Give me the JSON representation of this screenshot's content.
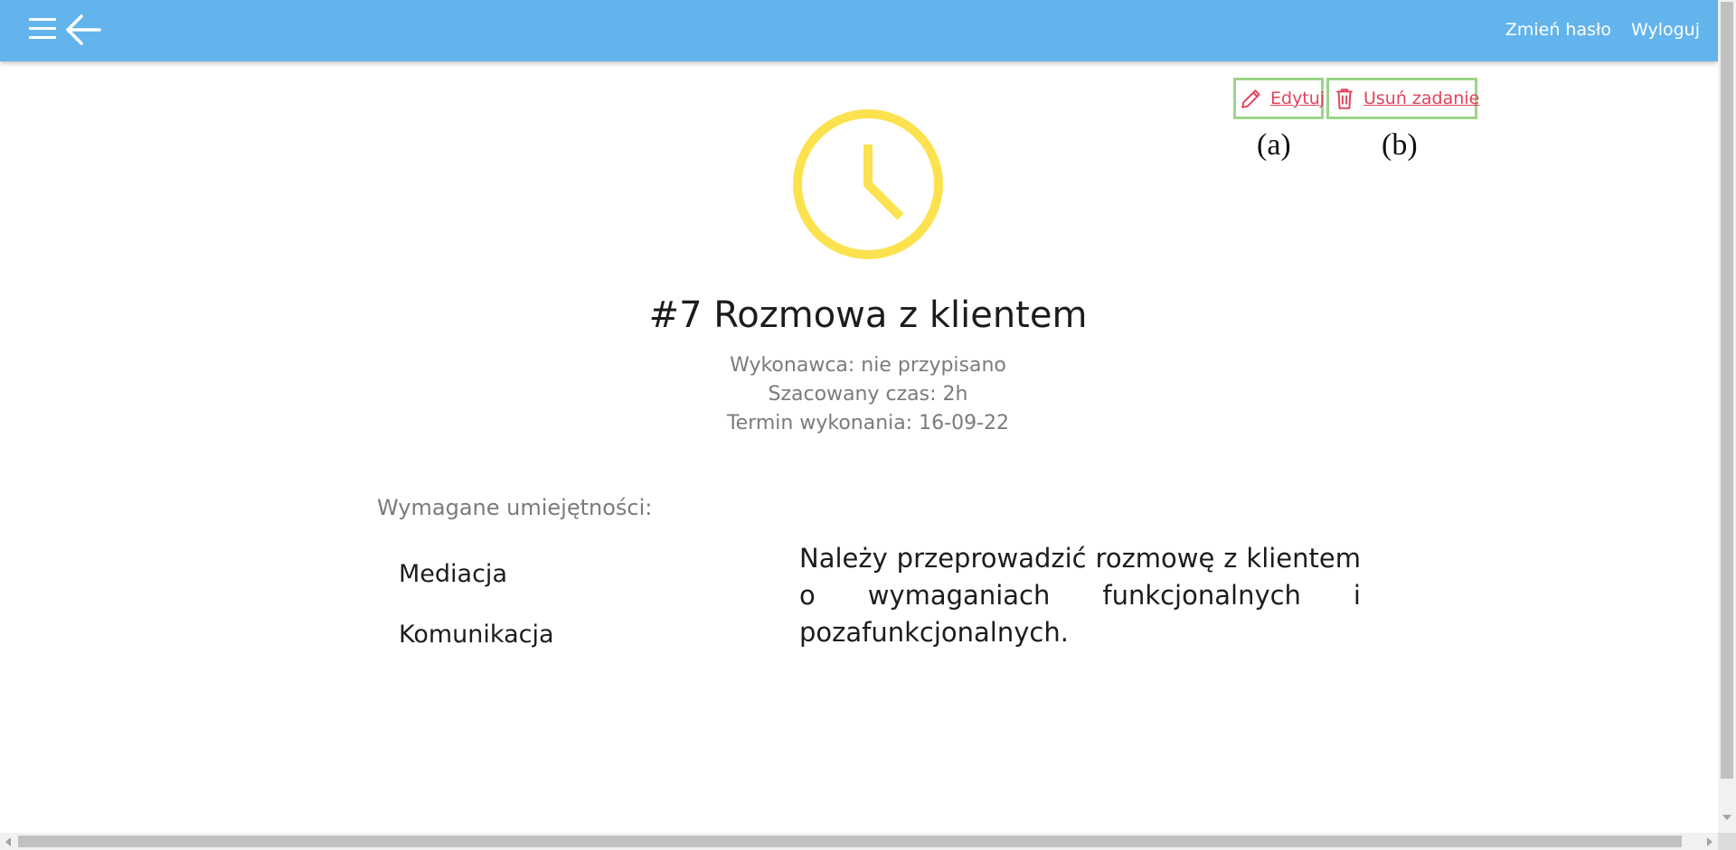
{
  "header": {
    "change_password": "Zmień hasło",
    "logout": "Wyloguj",
    "menu_icon": "hamburger-menu-icon",
    "back_icon": "arrow-left-icon",
    "background": "#63b4ec"
  },
  "actions": {
    "edit_label": "Edytuj",
    "delete_label": "Usuń zadanie",
    "edit_icon": "pencil-icon",
    "delete_icon": "trash-icon",
    "link_color": "#e0435a",
    "highlight_color": "#9bd58a",
    "annotation_a": "(a)",
    "annotation_b": "(b)"
  },
  "task": {
    "status_icon": "clock-icon",
    "status_color": "#fde24f",
    "title": "#7 Rozmowa z klientem",
    "assignee": "Wykonawca: nie przypisano",
    "estimated_time": "Szacowany czas: 2h",
    "deadline": "Termin wykonania: 16-09-22",
    "skills_heading": "Wymagane umiejętności:",
    "skills": [
      "Mediacja",
      "Komunikacja"
    ],
    "description": "Należy przeprowadzić rozmowę z klientem o wymaganiach funkcjonalnych i pozafunkcjonalnych."
  }
}
